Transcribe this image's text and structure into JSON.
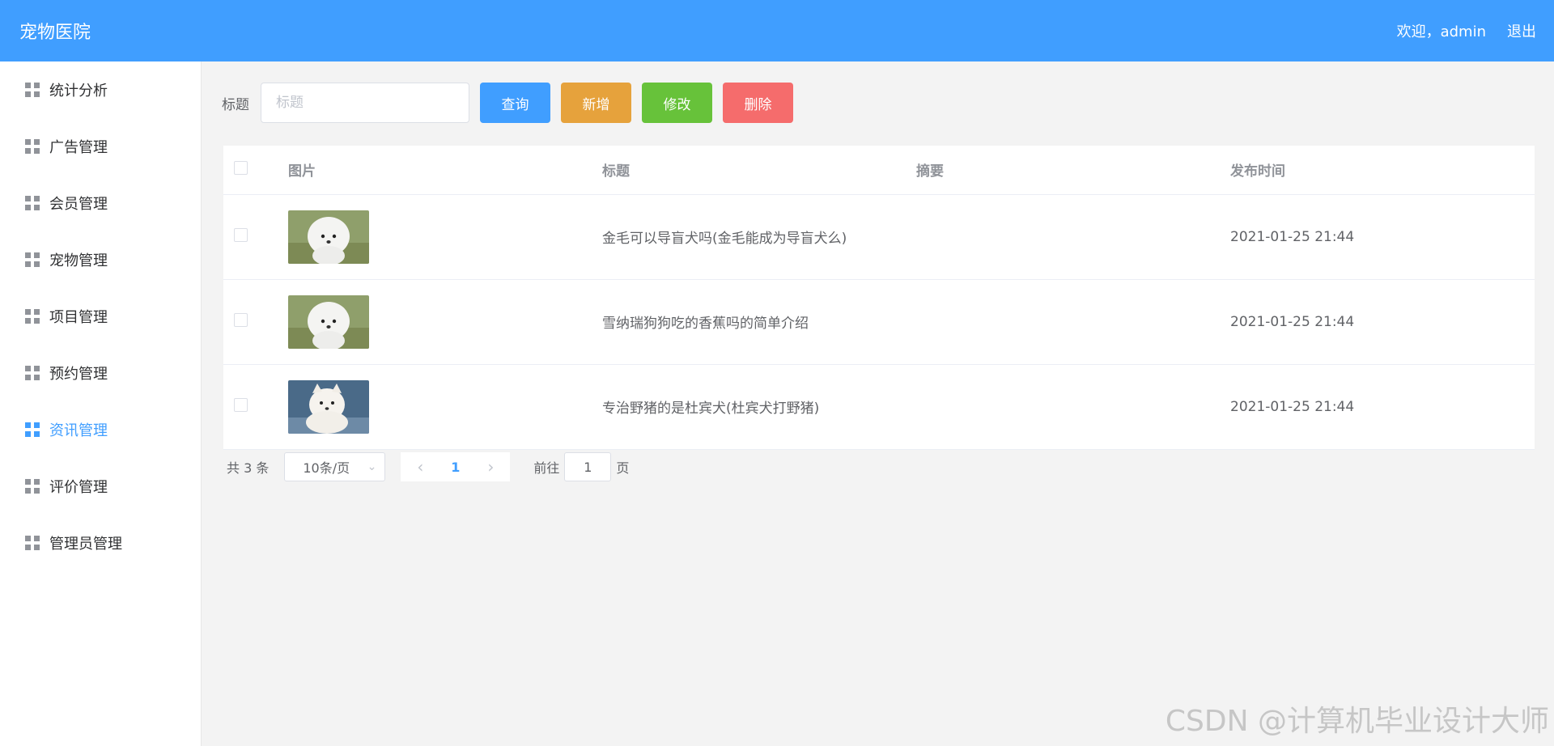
{
  "header": {
    "app_title": "宠物医院",
    "welcome": "欢迎，admin",
    "logout": "退出"
  },
  "sidebar": {
    "items": [
      {
        "label": "统计分析",
        "active": false
      },
      {
        "label": "广告管理",
        "active": false
      },
      {
        "label": "会员管理",
        "active": false
      },
      {
        "label": "宠物管理",
        "active": false
      },
      {
        "label": "项目管理",
        "active": false
      },
      {
        "label": "预约管理",
        "active": false
      },
      {
        "label": "资讯管理",
        "active": true
      },
      {
        "label": "评价管理",
        "active": false
      },
      {
        "label": "管理员管理",
        "active": false
      }
    ]
  },
  "toolbar": {
    "title_label": "标题",
    "search_placeholder": "标题",
    "search_value": "",
    "query_label": "查询",
    "add_label": "新增",
    "edit_label": "修改",
    "delete_label": "删除"
  },
  "table": {
    "columns": [
      "图片",
      "标题",
      "摘要",
      "发布时间"
    ],
    "rows": [
      {
        "image": "white-bichon-dog",
        "title": "金毛可以导盲犬吗(金毛能成为导盲犬么)",
        "summary": "",
        "published": "2021-01-25 21:44"
      },
      {
        "image": "white-bichon-dog",
        "title": "雪纳瑞狗狗吃的香蕉吗的简单介绍",
        "summary": "",
        "published": "2021-01-25 21:44"
      },
      {
        "image": "white-shiba-puppy",
        "title": "专治野猪的是杜宾犬(杜宾犬打野猪)",
        "summary": "",
        "published": "2021-01-25 21:44"
      }
    ]
  },
  "pagination": {
    "total_text": "共 3 条",
    "page_size": "10条/页",
    "current_page": "1",
    "goto_label": "前往",
    "goto_value": "1",
    "page_suffix": "页"
  },
  "watermark": "CSDN @计算机毕业设计大师",
  "colors": {
    "primary": "#409eff",
    "warning": "#e6a23c",
    "success": "#67c23a",
    "danger": "#f56c6c"
  }
}
